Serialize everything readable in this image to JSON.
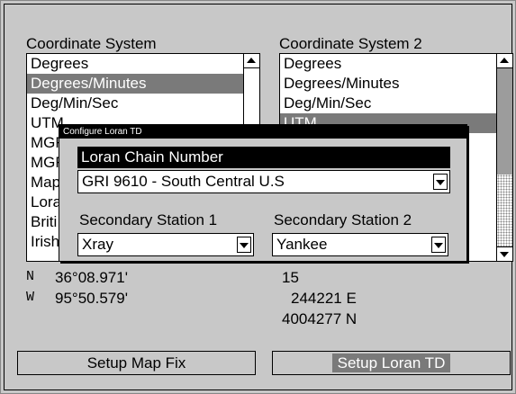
{
  "left_list": {
    "label": "Coordinate System",
    "items": [
      "Degrees",
      "Degrees/Minutes",
      "Deg/Min/Sec",
      "UTM",
      "MGR",
      "MGR",
      "Map",
      "Lora",
      "Briti",
      "Irish"
    ],
    "selected_index": 1
  },
  "right_list": {
    "label": "Coordinate System 2",
    "items": [
      "Degrees",
      "Degrees/Minutes",
      "Deg/Min/Sec",
      "UTM"
    ],
    "selected_index": 3
  },
  "coords_left": {
    "n_label": "N",
    "n_value": "36°08.971'",
    "w_label": "W",
    "w_value": "95°50.579'"
  },
  "coords_right": {
    "zone": "15",
    "easting": "244221 E",
    "northing": "4004277 N"
  },
  "buttons": {
    "setup_map_fix": "Setup Map Fix",
    "setup_loran_td": "Setup Loran TD"
  },
  "dialog": {
    "title": "Configure Loran TD",
    "chain_label": "Loran Chain Number",
    "chain_value": "GRI 9610 - South Central U.S",
    "secondary1_label": "Secondary Station 1",
    "secondary1_value": "Xray",
    "secondary2_label": "Secondary Station 2",
    "secondary2_value": "Yankee"
  }
}
